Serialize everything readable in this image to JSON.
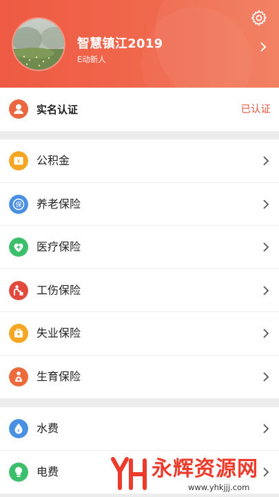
{
  "profile": {
    "name": "智慧镇江2019",
    "tag": "E动新人"
  },
  "auth": {
    "label": "实名认证",
    "status": "已认证"
  },
  "services": [
    {
      "label": "公积金",
      "icon": "housing-fund-icon",
      "color": "#f5a623"
    },
    {
      "label": "养老保险",
      "icon": "pension-insurance-icon",
      "color": "#4a90e2"
    },
    {
      "label": "医疗保险",
      "icon": "medical-insurance-icon",
      "color": "#3cbf6a"
    },
    {
      "label": "工伤保险",
      "icon": "injury-insurance-icon",
      "color": "#e2483c"
    },
    {
      "label": "失业保险",
      "icon": "unemployment-insurance-icon",
      "color": "#f5a623"
    },
    {
      "label": "生育保险",
      "icon": "maternity-insurance-icon",
      "color": "#ec6a3c"
    }
  ],
  "utilities": [
    {
      "label": "水费",
      "icon": "water-drop-icon",
      "color": "#4a90e2"
    },
    {
      "label": "电费",
      "icon": "lightbulb-icon",
      "color": "#3cbf6a"
    }
  ],
  "watermark": {
    "brand": "永辉资源网",
    "url": "www.yhkjjj.com"
  },
  "colors": {
    "header": "#ee5a43",
    "accent": "#e05a40"
  }
}
